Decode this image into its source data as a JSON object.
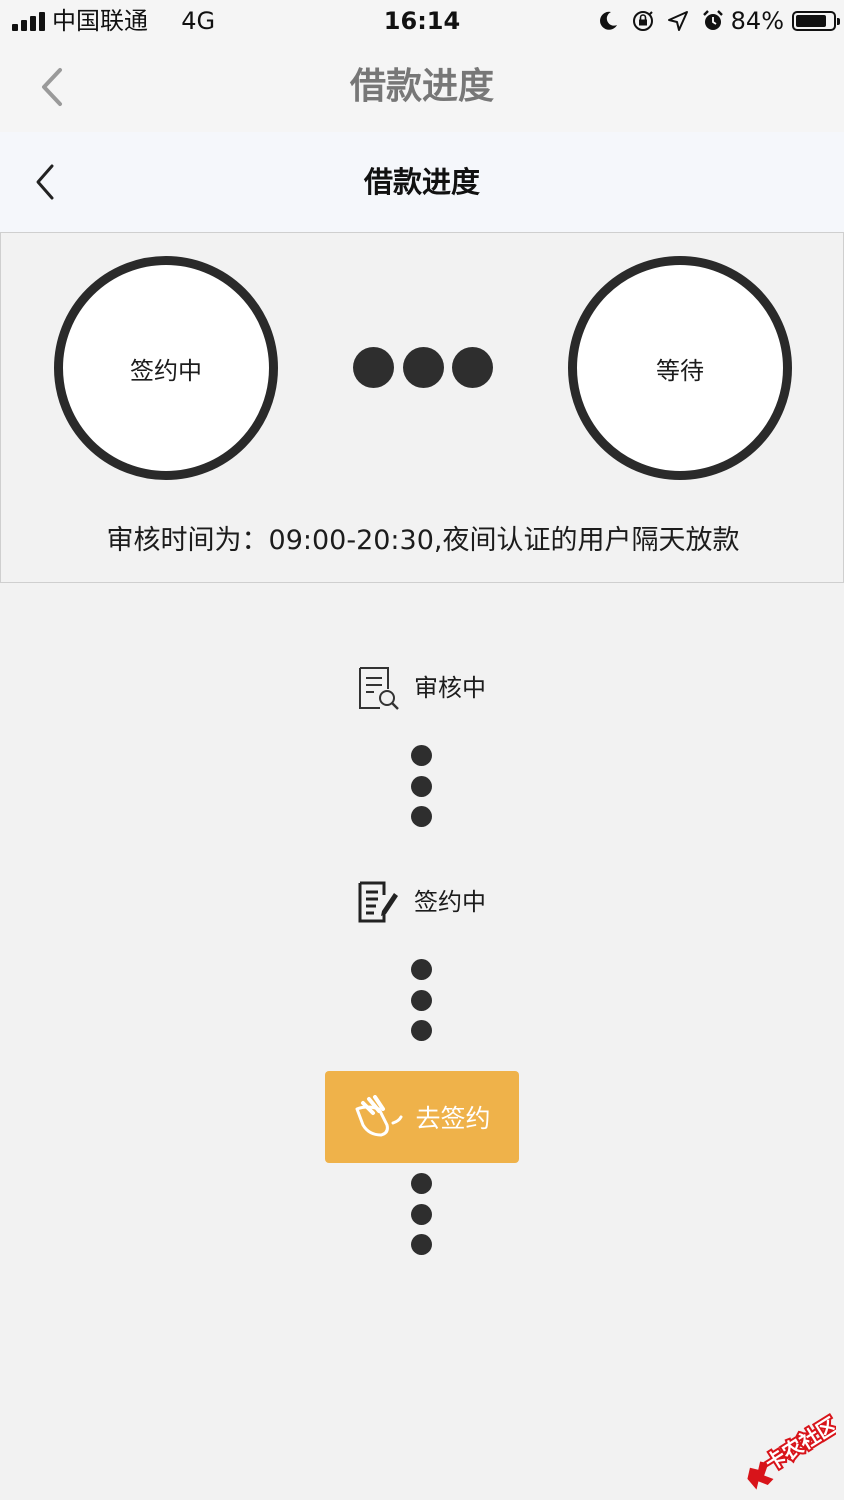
{
  "status_bar": {
    "carrier": "中国联通",
    "network": "4G",
    "time": "16:14",
    "battery_percent": "84%",
    "battery_level": 0.84
  },
  "outer_nav": {
    "title": "借款进度",
    "back_icon": "chevron-left-icon"
  },
  "inner_nav": {
    "title": "借款进度",
    "back_icon": "chevron-left-icon"
  },
  "progress": {
    "current_state": "签约中",
    "next_state": "等待",
    "notice": "审核时间为：09:00-20:30,夜间认证的用户隔天放款"
  },
  "steps": [
    {
      "label": "审核中",
      "icon": "document-search-icon"
    },
    {
      "label": "签约中",
      "icon": "document-edit-icon"
    }
  ],
  "action": {
    "label": "去签约",
    "icon": "signature-hand-icon",
    "color": "#efb24a"
  },
  "watermark": {
    "text": "卡农社区",
    "color": "#d8141a"
  }
}
